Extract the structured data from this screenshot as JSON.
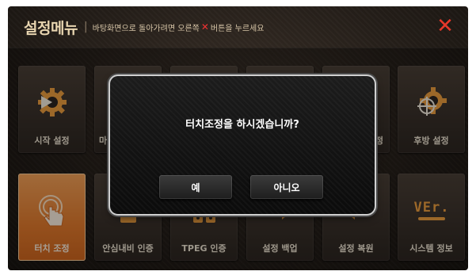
{
  "header": {
    "title": "설정메뉴",
    "separator": "|",
    "hint_before": "바탕화면으로 돌아가려면 오른쪽",
    "hint_x": "✕",
    "hint_after": "버튼을 누르세요",
    "close_symbol": "✕"
  },
  "tiles_row1": [
    {
      "label": "시작 설정",
      "icon": "gear-play-icon"
    },
    {
      "label": "마",
      "icon": ""
    },
    {
      "label": "",
      "icon": ""
    },
    {
      "label": "",
      "icon": ""
    },
    {
      "label": "정",
      "icon": ""
    },
    {
      "label": "후방 설정",
      "icon": "gear-crosshair-icon"
    }
  ],
  "tiles_row2": [
    {
      "label": "터치 조정",
      "icon": "touch-hand-icon",
      "active": true
    },
    {
      "label": "안심내비 인증",
      "icon": "lock-icon"
    },
    {
      "label": "TPEG 인증",
      "icon": "lock-tpeg-icon"
    },
    {
      "label": "설정 백업",
      "icon": "backup-arrows-icon"
    },
    {
      "label": "설정 복원",
      "icon": "restore-arrows-icon"
    },
    {
      "label": "시스템 정보",
      "icon": "version-icon"
    }
  ],
  "dialog": {
    "message": "터치조정을 하시겠습니까?",
    "yes_label": "예",
    "no_label": "아니오"
  },
  "version_text": "VEr.",
  "colors": {
    "accent_orange": "#e57c2d",
    "close_red": "#e8382a",
    "title_beige": "#e8d5b0"
  }
}
